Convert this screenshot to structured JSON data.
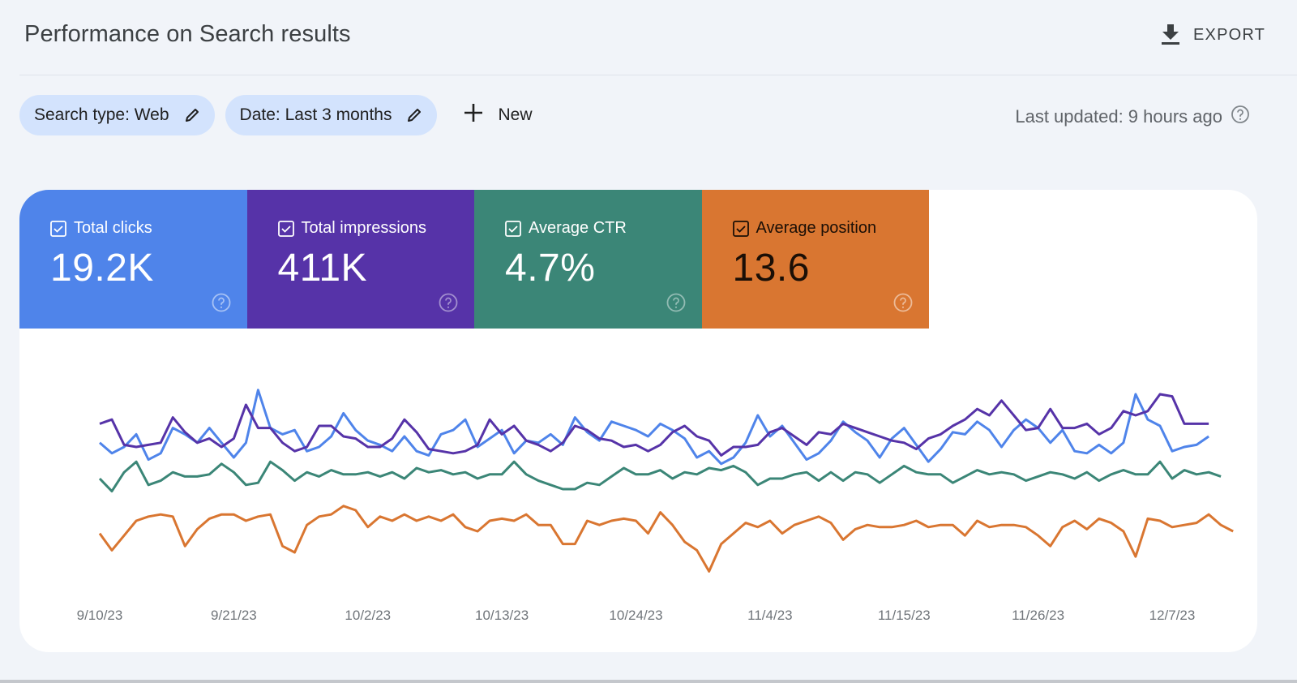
{
  "header": {
    "title": "Performance on Search results",
    "export_label": "EXPORT",
    "export_icon": "download-icon"
  },
  "filters": {
    "chips": [
      {
        "label": "Search type: Web",
        "icon": "edit-pencil-icon"
      },
      {
        "label": "Date: Last 3 months",
        "icon": "edit-pencil-icon"
      }
    ],
    "new_label": "New",
    "new_icon": "plus-icon",
    "last_updated": "Last updated: 9 hours ago",
    "help_icon": "help-circle-icon"
  },
  "metrics": [
    {
      "label": "Total clicks",
      "value": "19.2K",
      "checked": true,
      "color": "#4f84ea"
    },
    {
      "label": "Total impressions",
      "value": "411K",
      "checked": true,
      "color": "#5633a8"
    },
    {
      "label": "Average CTR",
      "value": "4.7%",
      "checked": true,
      "color": "#3b8677"
    },
    {
      "label": "Average position",
      "value": "13.6",
      "checked": true,
      "color": "#d97631"
    }
  ],
  "chart_data": {
    "type": "line",
    "title": "",
    "xlabel": "",
    "ylabel": "",
    "y_axis_visible": false,
    "y_scale_note": "No y-axis shown; values are normalized chart heights (0=bottom, 100=top) per series as drawn",
    "ylim": [
      0,
      100
    ],
    "grid": false,
    "legend": "metric cards above chart",
    "x_start": "9/10/23",
    "x_end": "12/9/23",
    "x_tick_labels": [
      "9/10/23",
      "9/21/23",
      "10/2/23",
      "10/13/23",
      "10/24/23",
      "11/4/23",
      "11/15/23",
      "11/26/23",
      "12/7/23"
    ],
    "x_tick_day_index": [
      0,
      11,
      22,
      33,
      44,
      55,
      66,
      77,
      88
    ],
    "series": [
      {
        "name": "Total impressions",
        "color": "#5633a8",
        "values": [
          76,
          78,
          66,
          65,
          66,
          67,
          79,
          72,
          67,
          69,
          65,
          69,
          85,
          74,
          74,
          67,
          63,
          65,
          75,
          75,
          70,
          69,
          65,
          65,
          69,
          78,
          72,
          64,
          63,
          62,
          63,
          66,
          78,
          71,
          75,
          68,
          66,
          63,
          67,
          75,
          73,
          69,
          68,
          65,
          66,
          63,
          66,
          72,
          75,
          70,
          68,
          61,
          65,
          65,
          66,
          72,
          74,
          70,
          66,
          72,
          71,
          76,
          74,
          72,
          70,
          68,
          67,
          64,
          69,
          71,
          75,
          78,
          83,
          80,
          87,
          80,
          73,
          74,
          83,
          74,
          74,
          76,
          71,
          74,
          82,
          80,
          82,
          90,
          89,
          76,
          76,
          76
        ]
      },
      {
        "name": "Total clicks",
        "color": "#4f84ea",
        "values": [
          67,
          62,
          65,
          71,
          59,
          62,
          74,
          71,
          67,
          74,
          67,
          60,
          67,
          92,
          74,
          71,
          73,
          63,
          65,
          70,
          81,
          73,
          68,
          66,
          63,
          70,
          63,
          61,
          71,
          73,
          78,
          65,
          69,
          73,
          62,
          68,
          67,
          71,
          66,
          79,
          72,
          68,
          77,
          75,
          73,
          70,
          76,
          73,
          69,
          60,
          63,
          57,
          60,
          67,
          80,
          70,
          75,
          67,
          59,
          62,
          68,
          77,
          72,
          68,
          60,
          69,
          74,
          66,
          58,
          64,
          72,
          71,
          77,
          73,
          65,
          73,
          78,
          74,
          67,
          73,
          63,
          62,
          66,
          62,
          67,
          90,
          78,
          75,
          63,
          65,
          66,
          70
        ]
      },
      {
        "name": "Average CTR",
        "color": "#3b8677",
        "values": [
          50,
          44,
          53,
          58,
          47,
          49,
          53,
          51,
          51,
          52,
          57,
          53,
          47,
          48,
          58,
          54,
          49,
          53,
          51,
          54,
          52,
          52,
          53,
          51,
          53,
          50,
          55,
          53,
          54,
          52,
          53,
          50,
          52,
          52,
          58,
          52,
          49,
          47,
          45,
          45,
          48,
          47,
          51,
          55,
          52,
          52,
          54,
          50,
          53,
          52,
          55,
          54,
          56,
          53,
          47,
          50,
          50,
          52,
          53,
          49,
          53,
          49,
          53,
          52,
          48,
          52,
          56,
          53,
          52,
          52,
          48,
          51,
          54,
          52,
          53,
          52,
          49,
          51,
          53,
          52,
          50,
          53,
          49,
          52,
          54,
          52,
          52,
          58,
          50,
          54,
          52,
          53,
          51
        ]
      },
      {
        "name": "Average position",
        "color": "#d97631",
        "values": [
          24,
          16,
          23,
          30,
          32,
          33,
          32,
          18,
          26,
          31,
          33,
          33,
          30,
          32,
          33,
          18,
          15,
          28,
          32,
          33,
          37,
          35,
          27,
          32,
          30,
          33,
          30,
          32,
          30,
          33,
          27,
          25,
          30,
          31,
          30,
          33,
          28,
          28,
          19,
          19,
          30,
          28,
          30,
          31,
          30,
          24,
          34,
          28,
          20,
          16,
          6,
          19,
          24,
          29,
          27,
          30,
          24,
          28,
          30,
          32,
          29,
          21,
          26,
          28,
          27,
          27,
          28,
          30,
          27,
          28,
          28,
          23,
          30,
          27,
          28,
          28,
          27,
          23,
          18,
          27,
          30,
          26,
          31,
          29,
          25,
          13,
          31,
          30,
          27,
          28,
          29,
          33,
          28,
          25
        ]
      }
    ]
  }
}
